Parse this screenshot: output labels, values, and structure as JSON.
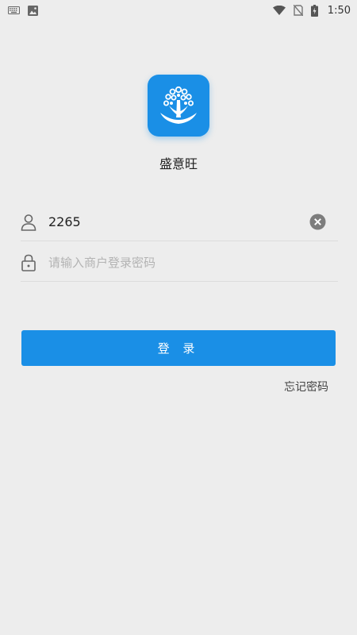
{
  "status_bar": {
    "time": "1:50",
    "left_icons": [
      "keyboard-icon",
      "image-icon"
    ],
    "right_icons": [
      "wifi-icon",
      "no-sim-icon",
      "battery-charging-icon"
    ]
  },
  "app": {
    "name": "盛意旺",
    "logo_icon": "tree-icon",
    "brand_color": "#1a8fe6"
  },
  "form": {
    "username": {
      "icon": "user-icon",
      "value": "2265",
      "clear_icon": "clear-icon"
    },
    "password": {
      "icon": "lock-icon",
      "value": "",
      "placeholder": "请输入商户登录密码"
    }
  },
  "actions": {
    "login_label": "登 录",
    "forgot_label": "忘记密码"
  }
}
